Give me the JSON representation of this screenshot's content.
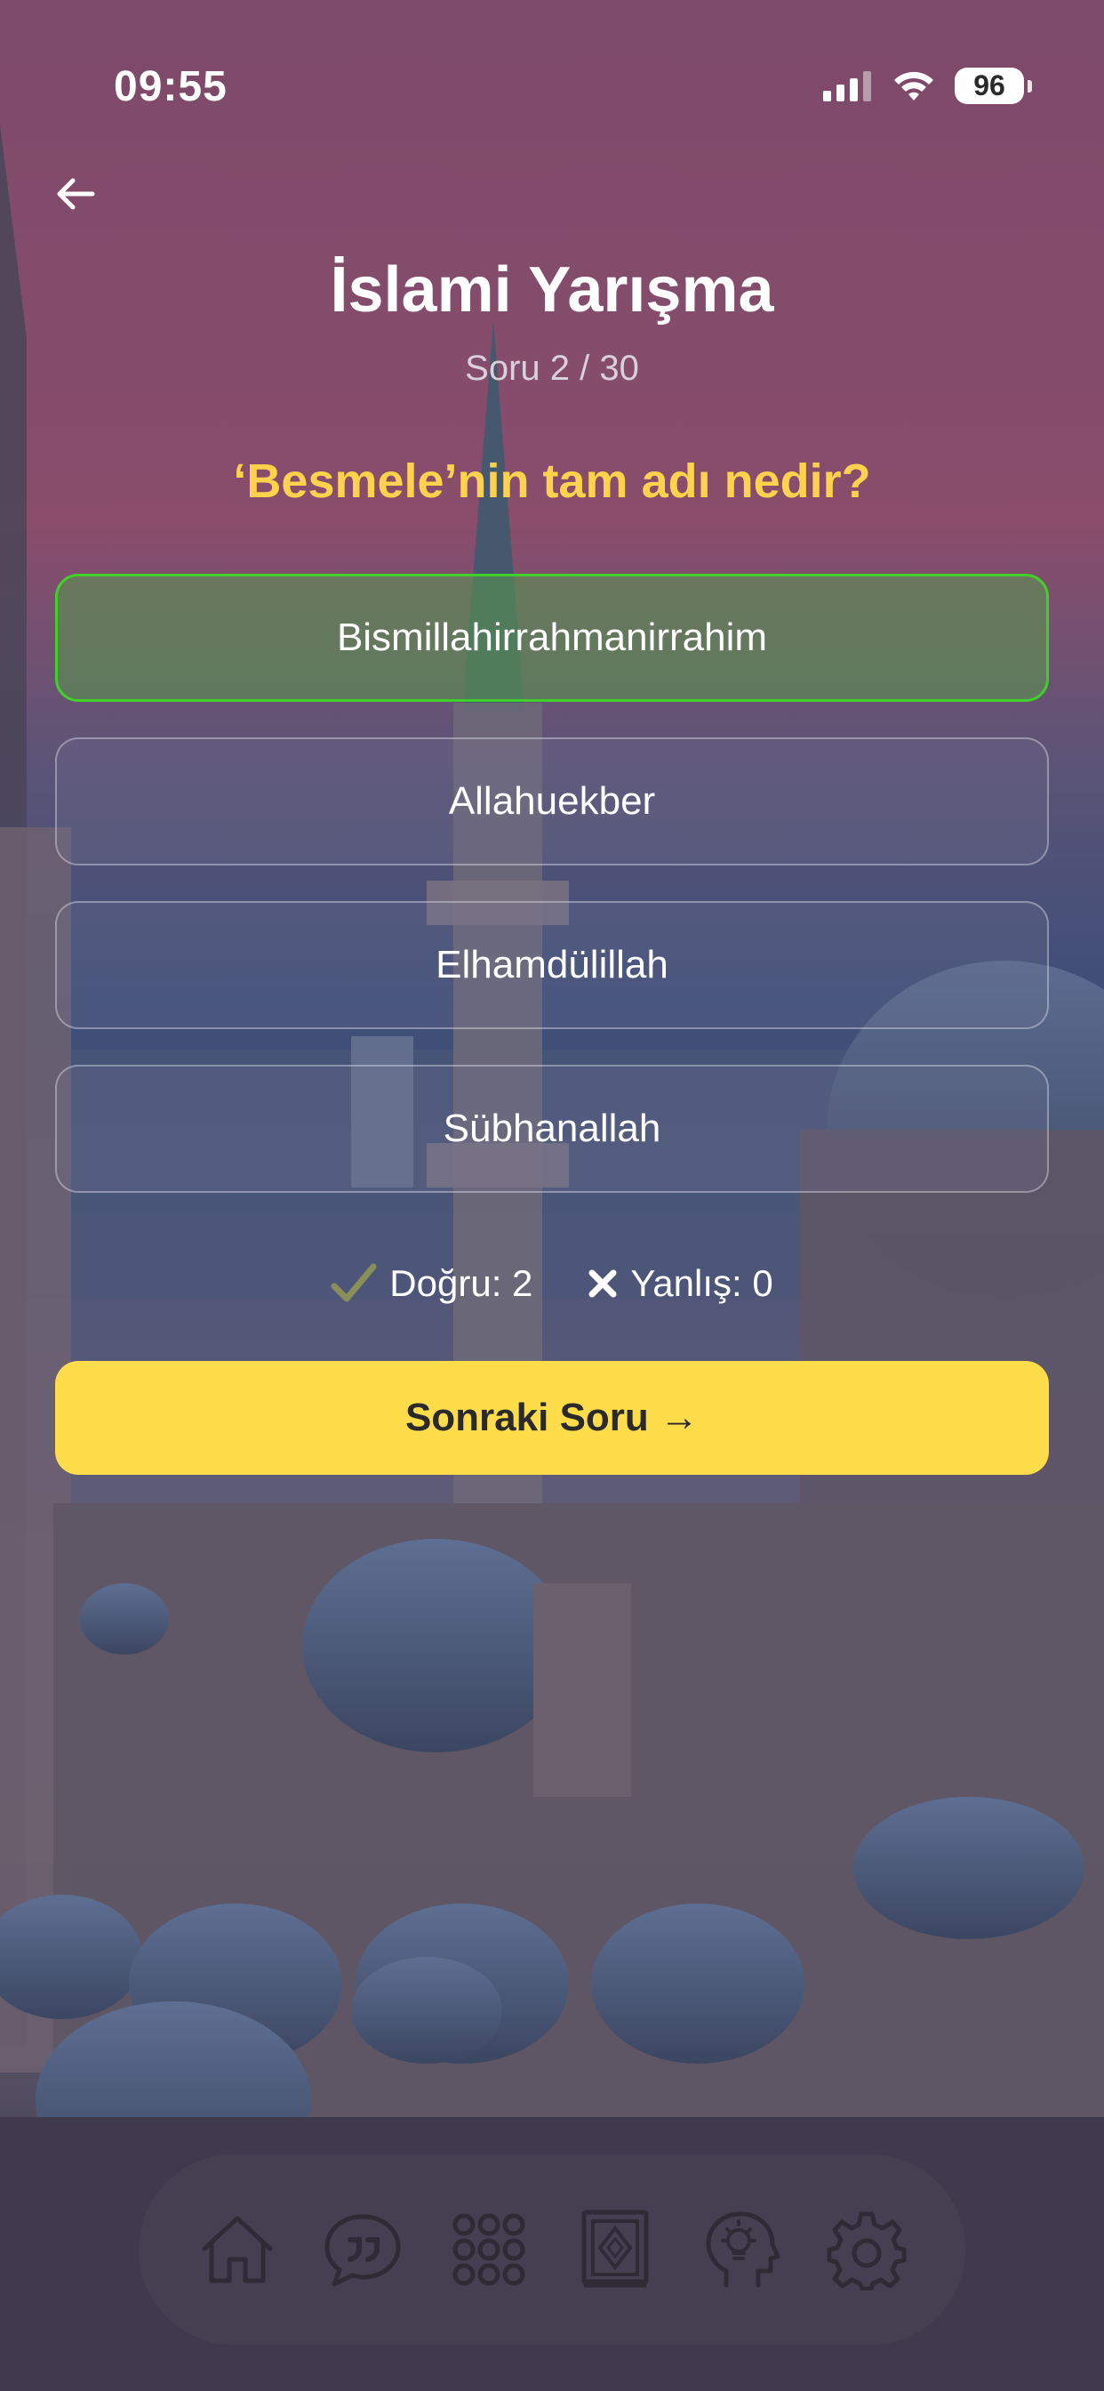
{
  "status_bar": {
    "time": "09:55",
    "battery": "96"
  },
  "header": {
    "title": "İslami Yarışma",
    "counter": "Soru 2 / 30"
  },
  "question": {
    "text": "‘Besmele’nin tam adı nedir?"
  },
  "options": [
    {
      "label": "Bismillahirrahmanirrahim",
      "state": "correct"
    },
    {
      "label": "Allahuekber",
      "state": "default"
    },
    {
      "label": "Elhamdülillah",
      "state": "default"
    },
    {
      "label": "Sübhanallah",
      "state": "default"
    }
  ],
  "score": {
    "correct_label": "Doğru: 2",
    "wrong_label": "Yanlış: 0"
  },
  "next_button": {
    "label": "Sonraki Soru →"
  },
  "bottom_nav": {
    "items": [
      {
        "icon": "home-icon"
      },
      {
        "icon": "quote-bubble-icon"
      },
      {
        "icon": "grid-icon"
      },
      {
        "icon": "quran-book-icon"
      },
      {
        "icon": "idea-head-icon"
      },
      {
        "icon": "gear-icon"
      }
    ]
  },
  "colors": {
    "accent_yellow": "#ffdc4a",
    "question_yellow": "#ffd24d",
    "correct_green": "#3fd128"
  }
}
